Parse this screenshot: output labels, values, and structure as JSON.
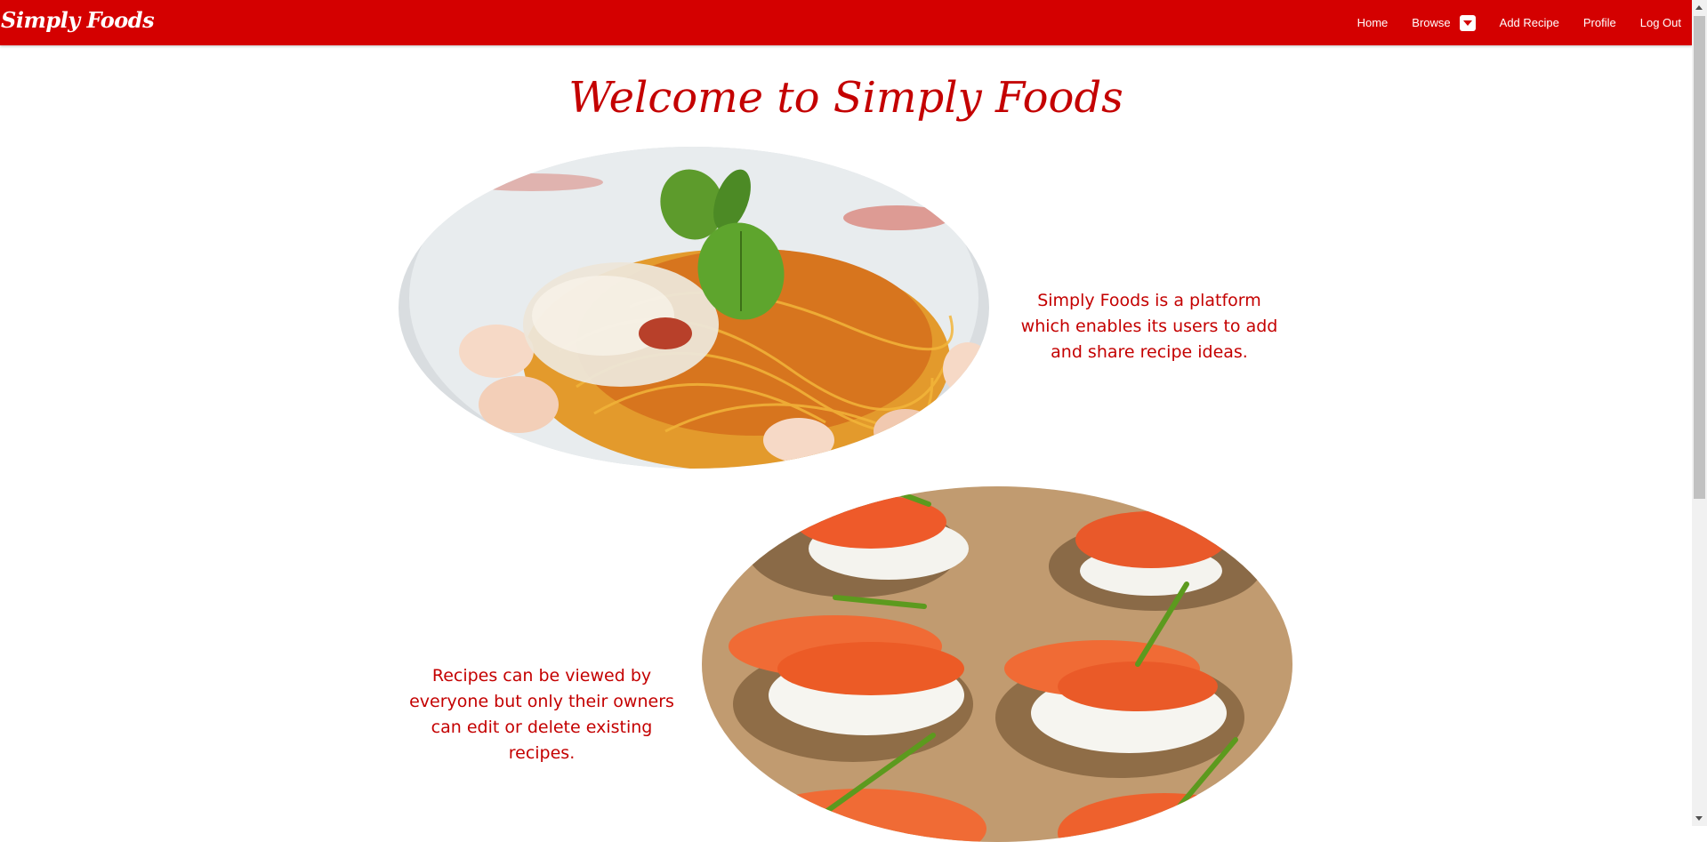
{
  "navbar": {
    "brand": "Simply Foods",
    "links": {
      "home": "Home",
      "browse": "Browse",
      "add_recipe": "Add Recipe",
      "profile": "Profile",
      "logout": "Log Out"
    }
  },
  "main": {
    "title": "Welcome to Simply Foods",
    "intro_1": "Simply Foods is a platform which enables its users to add and share recipe ideas.",
    "intro_2": "Recipes can be viewed by everyone but only their owners can edit or delete existing recipes."
  },
  "colors": {
    "brand_red": "#d40000",
    "text_red": "#c40000"
  },
  "icons": {
    "browse_dropdown": "caret-down-icon"
  }
}
